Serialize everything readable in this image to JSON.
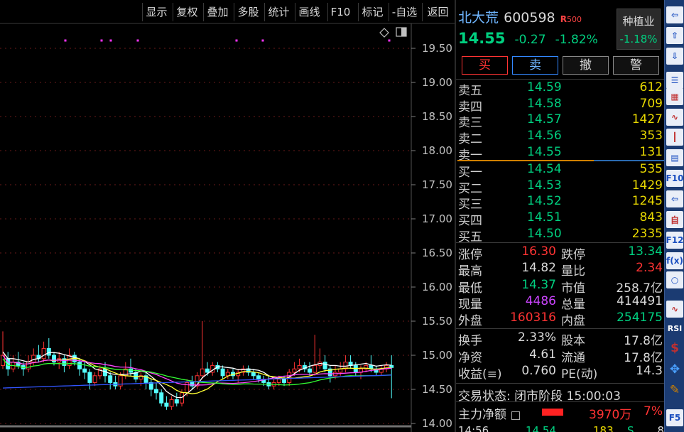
{
  "toolbar": [
    "显示",
    "复权",
    "叠加",
    "多股",
    "统计",
    "画线",
    "F10",
    "标记",
    "-自选",
    "返回"
  ],
  "y_axis": [
    "19.50",
    "19.00",
    "18.50",
    "18.00",
    "17.50",
    "17.00",
    "16.50",
    "16.00",
    "15.50",
    "15.00",
    "14.50",
    "14.00"
  ],
  "chart_icons": {
    "diamond": "diamond-icon",
    "toggle": "panel-toggle-icon"
  },
  "stock": {
    "name": "北大荒",
    "code": "600598",
    "r_tag": "R",
    "index_tag": "500",
    "price": "14.55",
    "change": "-0.27",
    "change_pct": "-1.82%",
    "sector": "种植业",
    "sector_pct": "-1.18%"
  },
  "actions": [
    "买",
    "卖",
    "撤",
    "警"
  ],
  "asks": [
    {
      "label": "卖五",
      "price": "14.59",
      "vol": "612"
    },
    {
      "label": "卖四",
      "price": "14.58",
      "vol": "709"
    },
    {
      "label": "卖三",
      "price": "14.57",
      "vol": "1427"
    },
    {
      "label": "卖二",
      "price": "14.56",
      "vol": "353"
    },
    {
      "label": "卖一",
      "price": "14.55",
      "vol": "131"
    }
  ],
  "bids": [
    {
      "label": "买一",
      "price": "14.54",
      "vol": "535"
    },
    {
      "label": "买二",
      "price": "14.53",
      "vol": "1429"
    },
    {
      "label": "买三",
      "price": "14.52",
      "vol": "1245"
    },
    {
      "label": "买四",
      "price": "14.51",
      "vol": "843"
    },
    {
      "label": "买五",
      "price": "14.50",
      "vol": "2335"
    }
  ],
  "stats": [
    {
      "l1": "涨停",
      "v1": "16.30",
      "l2": "跌停",
      "v2": "13.34"
    },
    {
      "l1": "最高",
      "v1": "14.82",
      "l2": "量比",
      "v2": "2.34"
    },
    {
      "l1": "最低",
      "v1": "14.37",
      "l2": "市值",
      "v2": "258.7亿"
    },
    {
      "l1": "现量",
      "v1": "4486",
      "l2": "总量",
      "v2": "414491"
    },
    {
      "l1": "外盘",
      "v1": "160316",
      "l2": "内盘",
      "v2": "254175"
    }
  ],
  "stats2": [
    {
      "l1": "换手",
      "v1": "2.33%",
      "l2": "股本",
      "v2": "17.8亿"
    },
    {
      "l1": "净资",
      "v1": "4.61",
      "l2": "流通",
      "v2": "17.8亿"
    },
    {
      "l1": "收益(≡)",
      "v1": "0.760",
      "l2": "PE(动)",
      "v2": "14.3"
    }
  ],
  "trade_status": "交易状态: 闭市阶段 15:00:03",
  "main_flow": {
    "label": "主力净额",
    "amount": "3970万",
    "pct": "7%"
  },
  "tick": {
    "time": "14:56",
    "price": "14.54",
    "vol": "183",
    "side": "S",
    "extra": "8"
  },
  "side_icons": [
    "arrow-left-icon",
    "arrow-up-icon",
    "arrow-down-icon",
    "list-icon",
    "table-icon",
    "line-chart-icon",
    "candlestick-icon",
    "document-icon",
    "f10-icon",
    "export-icon",
    "self-select-icon",
    "f12-icon",
    "formula-icon",
    "circle-icon",
    "wave-icon",
    "rsi-icon",
    "dollar-icon",
    "move-icon",
    "pencil-icon",
    "f5-icon"
  ],
  "side_labels": {
    "f10": "F10",
    "self": "自",
    "f12": "F12",
    "fx": "f(x)",
    "rsi": "RSI",
    "dollar": "$",
    "f5": "F5"
  },
  "colors": {
    "up": "#ff3333",
    "down": "#00d080",
    "vol": "#e8d800",
    "purple": "#cc44ff"
  },
  "chart_data": {
    "type": "candlestick",
    "ylim": [
      14.0,
      19.75
    ],
    "y_ticks": [
      14.0,
      14.5,
      15.0,
      15.5,
      16.0,
      16.5,
      17.0,
      17.5,
      18.0,
      18.5,
      19.0,
      19.5
    ],
    "candles": [
      [
        14.85,
        15.0,
        15.35,
        14.8
      ],
      [
        14.95,
        14.8,
        15.05,
        14.7
      ],
      [
        14.8,
        14.9,
        15.0,
        14.75
      ],
      [
        14.9,
        14.85,
        15.05,
        14.8
      ],
      [
        14.85,
        14.8,
        14.9,
        14.7
      ],
      [
        14.8,
        14.9,
        15.0,
        14.75
      ],
      [
        14.9,
        15.0,
        15.1,
        14.85
      ],
      [
        15.0,
        14.95,
        15.15,
        14.9
      ],
      [
        14.95,
        15.1,
        15.2,
        14.9
      ],
      [
        15.1,
        15.0,
        15.25,
        14.95
      ],
      [
        15.0,
        14.9,
        15.05,
        14.85
      ],
      [
        14.9,
        14.95,
        15.05,
        14.8
      ],
      [
        14.95,
        14.85,
        15.0,
        14.75
      ],
      [
        14.85,
        15.0,
        15.1,
        14.8
      ],
      [
        15.0,
        14.9,
        15.05,
        14.85
      ],
      [
        14.9,
        14.8,
        14.95,
        14.7
      ],
      [
        14.8,
        14.75,
        14.9,
        14.65
      ],
      [
        14.75,
        14.6,
        14.8,
        14.5
      ],
      [
        14.6,
        14.7,
        14.75,
        14.55
      ],
      [
        14.7,
        14.8,
        14.85,
        14.65
      ],
      [
        14.8,
        14.7,
        14.9,
        14.6
      ],
      [
        14.7,
        14.6,
        14.75,
        14.5
      ],
      [
        14.6,
        14.55,
        14.7,
        14.5
      ],
      [
        14.55,
        14.7,
        14.75,
        14.5
      ],
      [
        14.7,
        14.8,
        14.9,
        14.65
      ],
      [
        14.8,
        14.75,
        14.95,
        14.7
      ],
      [
        14.75,
        14.65,
        14.8,
        14.6
      ],
      [
        14.65,
        14.7,
        14.75,
        14.55
      ],
      [
        14.7,
        14.6,
        14.75,
        14.5
      ],
      [
        14.6,
        14.5,
        14.65,
        14.4
      ],
      [
        14.5,
        14.45,
        14.6,
        14.35
      ],
      [
        14.45,
        14.3,
        14.5,
        14.25
      ],
      [
        14.3,
        14.25,
        14.4,
        14.2
      ],
      [
        14.25,
        14.35,
        14.4,
        14.2
      ],
      [
        14.35,
        14.3,
        14.45,
        14.25
      ],
      [
        14.3,
        14.45,
        14.5,
        14.25
      ],
      [
        14.45,
        14.6,
        14.65,
        14.4
      ],
      [
        14.6,
        14.55,
        14.7,
        14.5
      ],
      [
        14.55,
        14.7,
        14.75,
        14.5
      ],
      [
        14.7,
        14.8,
        15.5,
        14.65
      ],
      [
        14.8,
        14.75,
        14.9,
        14.7
      ],
      [
        14.75,
        14.85,
        14.9,
        14.7
      ],
      [
        14.85,
        14.8,
        14.9,
        14.75
      ],
      [
        14.8,
        14.7,
        14.85,
        14.65
      ],
      [
        14.7,
        14.75,
        14.8,
        14.65
      ],
      [
        14.75,
        14.7,
        14.8,
        14.65
      ],
      [
        14.7,
        14.75,
        14.8,
        14.6
      ],
      [
        14.75,
        14.8,
        14.85,
        14.7
      ],
      [
        14.8,
        14.75,
        14.85,
        14.7
      ],
      [
        14.75,
        14.7,
        14.8,
        14.65
      ],
      [
        14.7,
        14.65,
        14.75,
        14.6
      ],
      [
        14.65,
        14.6,
        14.7,
        14.55
      ],
      [
        14.6,
        14.55,
        14.7,
        14.5
      ],
      [
        14.55,
        14.6,
        14.65,
        14.5
      ],
      [
        14.6,
        14.65,
        14.7,
        14.55
      ],
      [
        14.65,
        14.6,
        14.7,
        14.55
      ],
      [
        14.6,
        14.75,
        14.8,
        14.55
      ],
      [
        14.75,
        14.8,
        14.9,
        14.7
      ],
      [
        14.8,
        14.85,
        14.95,
        14.75
      ],
      [
        14.85,
        14.8,
        14.9,
        14.75
      ],
      [
        14.8,
        14.75,
        14.9,
        14.7
      ],
      [
        14.75,
        14.85,
        15.3,
        14.7
      ],
      [
        14.85,
        14.9,
        15.1,
        14.8
      ],
      [
        14.9,
        14.8,
        15.0,
        14.75
      ],
      [
        14.8,
        14.7,
        14.85,
        14.6
      ],
      [
        14.7,
        14.75,
        14.85,
        14.65
      ],
      [
        14.75,
        14.8,
        14.9,
        14.7
      ],
      [
        14.8,
        14.9,
        15.0,
        14.75
      ],
      [
        14.9,
        14.85,
        15.0,
        14.8
      ],
      [
        14.85,
        14.75,
        14.9,
        14.7
      ],
      [
        14.75,
        14.8,
        14.85,
        14.65
      ],
      [
        14.8,
        14.85,
        14.9,
        14.75
      ],
      [
        14.85,
        14.8,
        15.0,
        14.75
      ],
      [
        14.8,
        14.75,
        14.85,
        14.7
      ],
      [
        14.75,
        14.8,
        14.85,
        14.7
      ],
      [
        14.8,
        14.85,
        14.9,
        14.75
      ],
      [
        14.85,
        14.82,
        15.0,
        14.37
      ]
    ]
  }
}
